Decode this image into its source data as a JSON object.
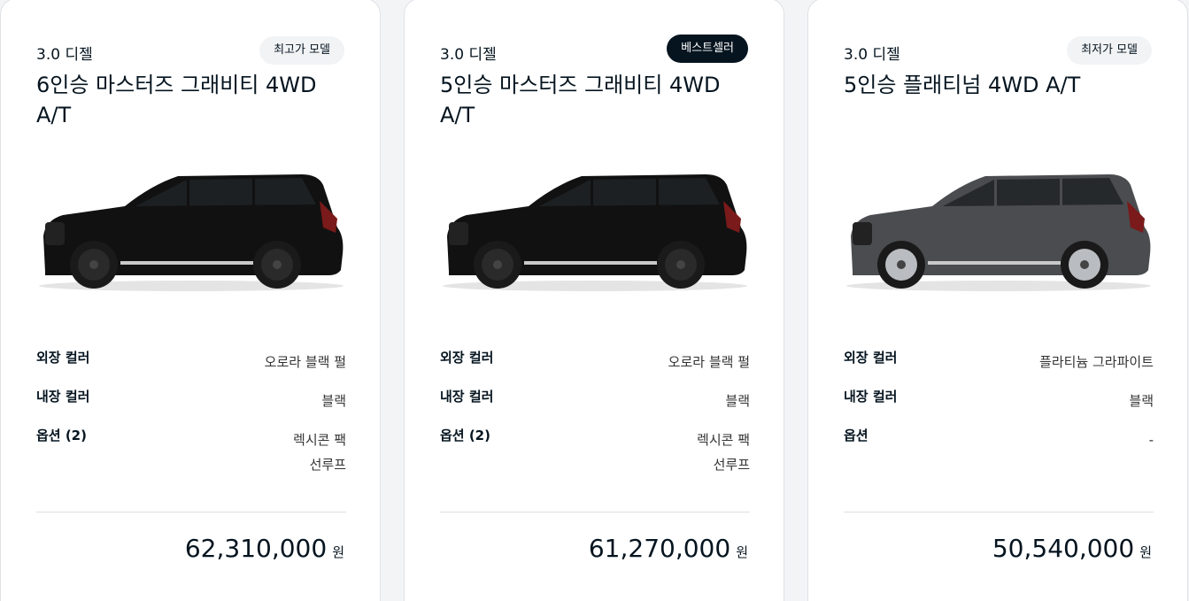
{
  "cards": [
    {
      "engine": "3.0 디젤",
      "badge": "최고가 모델",
      "model": "6인승 마스터즈 그래비티 4WD A/T",
      "specs": {
        "exterior_label": "외장 컬러",
        "exterior_value": "오로라 블랙 펄",
        "interior_label": "내장 컬러",
        "interior_value": "블랙",
        "option_label": "옵션 (2)",
        "option_values": [
          "렉시콘 팩",
          "선루프"
        ]
      },
      "price": "62,310,000",
      "currency": "원",
      "car_color": "#111111"
    },
    {
      "engine": "3.0 디젤",
      "badge": "베스트셀러",
      "model": "5인승 마스터즈 그래비티 4WD A/T",
      "specs": {
        "exterior_label": "외장 컬러",
        "exterior_value": "오로라 블랙 펄",
        "interior_label": "내장 컬러",
        "interior_value": "블랙",
        "option_label": "옵션 (2)",
        "option_values": [
          "렉시콘 팩",
          "선루프"
        ]
      },
      "price": "61,270,000",
      "currency": "원",
      "car_color": "#111111"
    },
    {
      "engine": "3.0 디젤",
      "badge": "최저가 모델",
      "model": "5인승 플래티넘 4WD A/T",
      "specs": {
        "exterior_label": "외장 컬러",
        "exterior_value": "플라티늄 그라파이트",
        "interior_label": "내장 컬러",
        "interior_value": "블랙",
        "option_label": "옵션",
        "option_values": [
          "-"
        ]
      },
      "price": "50,540,000",
      "currency": "원",
      "car_color": "#4a4c4f"
    }
  ],
  "colors": {
    "text_primary": "#05141f",
    "badge_dark": "#05141f",
    "badge_light": "#f2f3f5",
    "page_bg": "#f3f4f6",
    "card_bg": "#ffffff"
  }
}
